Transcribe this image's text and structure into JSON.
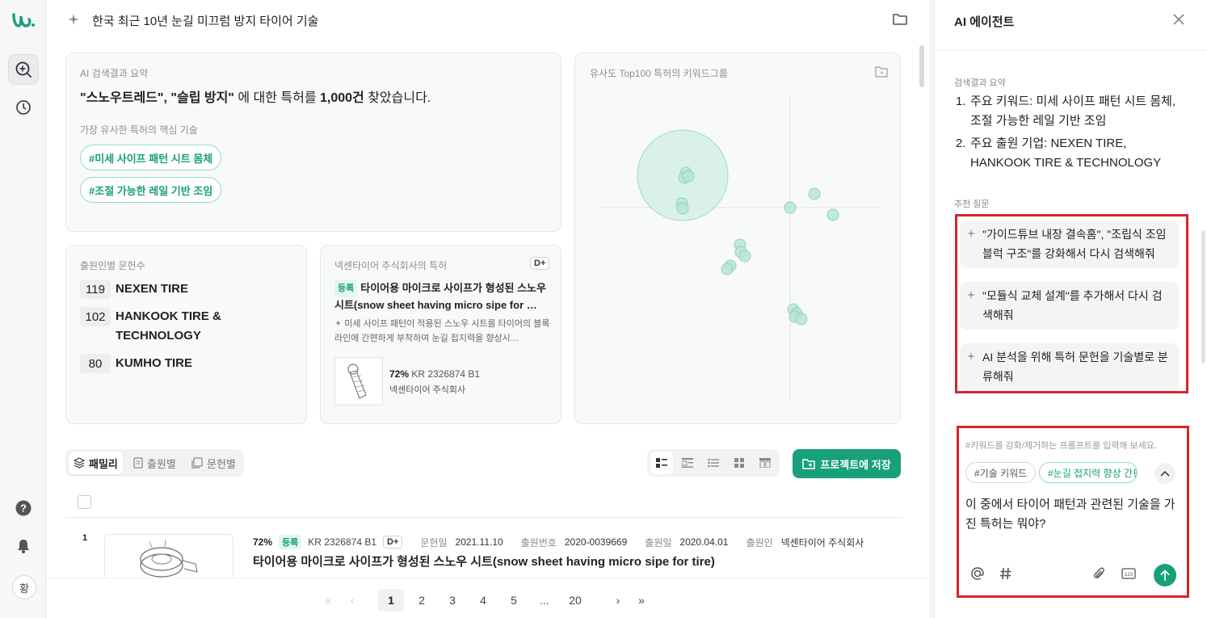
{
  "search": {
    "title": "한국 최근 10년 눈길 미끄럼 방지 타이어 기술"
  },
  "summary": {
    "label": "AI 검색결과 요약",
    "keywords": "\"스노우트레드\", \"슬립 방지\"",
    "mid": " 에 대한 특허를 ",
    "count": "1,000건",
    "tail": " 찾았습니다.",
    "core_label": "가장 유사한 특허의 핵심 기술",
    "tags": [
      "#미세 사이프 패턴 시트 몸체",
      "#조절 가능한 레일 기반 조임"
    ]
  },
  "scatter": {
    "label": "유사도 Top100 특허의 키워드그룹",
    "color": "#7fd1b6"
  },
  "applicants": {
    "label": "출원인별 문헌수",
    "rows": [
      {
        "count": "119",
        "name": "NEXEN TIRE"
      },
      {
        "count": "102",
        "name": "HANKOOK TIRE & TECHNOLOGY"
      },
      {
        "count": "80",
        "name": "KUMHO TIRE"
      }
    ]
  },
  "nexen": {
    "label": "넥센타이어 주식회사의 특허",
    "grade": "D+",
    "badge": "등록",
    "title": "타이어용 마이크로 사이프가 형성된 스노우 시트(snow sheet having micro sipe for …",
    "desc": "미세 사이프 패턴이 적용된 스노우 시트를 타이어의 블록 라인에 간편하게 부착하여 눈길 접지력을 향상시…",
    "score": "72%",
    "number": "KR 2326874 B1",
    "owner": "넥센타이어 주식회사"
  },
  "tabs": [
    "패밀리",
    "출원별",
    "문헌별"
  ],
  "save_project": "프로젝트에 저장",
  "result": {
    "index": "1",
    "score": "72%",
    "badge": "등록",
    "number": "KR 2326874 B1",
    "grade": "D+",
    "pub_label": "문헌일",
    "pub_date": "2021.11.10",
    "app_no_label": "출원번호",
    "app_no": "2020-0039669",
    "app_date_label": "출원일",
    "app_date": "2020.04.01",
    "applicant_label": "출원인",
    "applicant": "넥센타이어 주식회사",
    "title": "타이어용 마이크로 사이프가 형성된 스노우 시트(snow sheet having micro sipe for tire)"
  },
  "pager": {
    "pages": [
      "1",
      "2",
      "3",
      "4",
      "5",
      "...",
      "20"
    ],
    "current": "1"
  },
  "agent": {
    "title": "AI 에이전트",
    "summary_label": "검색결과 요약",
    "items": [
      {
        "n": "1.",
        "text": "주요 키워드: 미세 사이프 패턴 시트 몸체, 조절 가능한 레일 기반 조임"
      },
      {
        "n": "2.",
        "text": "주요 출원 기업: NEXEN TIRE, HANKOOK TIRE & TECHNOLOGY"
      }
    ],
    "rec_label": "추천 질문",
    "suggestions": [
      "\"가이드튜브 내장 결속홈\", \"조립식 조임 블럭 구조\"를 강화해서 다시 검색해줘",
      "\"모듈식 교체 설계\"를 추가해서 다시 검색해줘",
      "AI 분석을 위해 특허 문헌을 기술별로 분류해줘"
    ],
    "input_hint": "#키워드를 강화/제거하는 프롬프트를 입력해 보세요.",
    "chips": [
      "#기술 키워드",
      "#눈길 접지력 향상 간편"
    ],
    "prompt": "이 중에서 타이어 패턴과 관련된 기술을 가진 특허는 뭐야?"
  },
  "user": {
    "initial": "황"
  },
  "colors": {
    "accent": "#17a07a",
    "highlight": "#d7242c"
  }
}
